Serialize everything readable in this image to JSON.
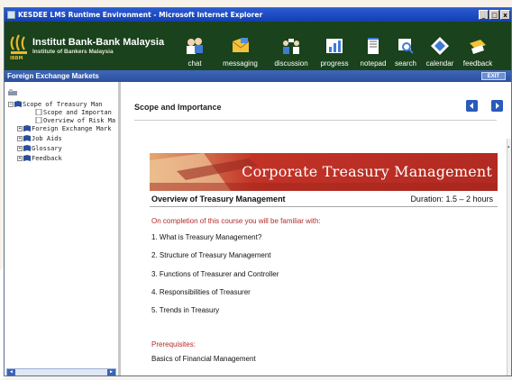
{
  "window": {
    "title": "KESDEE LMS Runtime Environment - Microsoft Internet Explorer",
    "controls": [
      "_",
      "□",
      "x"
    ]
  },
  "banner": {
    "org_name": "Institut Bank-Bank Malaysia",
    "org_subtitle": "Institute of Bankers Malaysia",
    "logo_abbr": "IBBM"
  },
  "toolbar": {
    "items": [
      {
        "label": "chat",
        "icon": "chat-icon"
      },
      {
        "label": "messaging",
        "icon": "messaging-icon"
      },
      {
        "label": "discussion",
        "icon": "discussion-icon"
      },
      {
        "label": "progress",
        "icon": "progress-icon"
      },
      {
        "label": "notepad",
        "icon": "notepad-icon"
      },
      {
        "label": "search",
        "icon": "search-icon"
      },
      {
        "label": "calendar",
        "icon": "calendar-icon"
      },
      {
        "label": "feedback",
        "icon": "feedback-icon"
      }
    ]
  },
  "coursebar": {
    "title": "Foreign Exchange Markets",
    "exit_label": "EXIT"
  },
  "nav": {
    "tree": [
      {
        "label": "Scope of Treasury Man",
        "expander": "⊟",
        "level": 0
      },
      {
        "label": "Scope and Importan",
        "expander": "",
        "level": 1
      },
      {
        "label": "Overview of Risk Ma",
        "expander": "",
        "level": 1
      },
      {
        "label": "Foreign Exchange Mark",
        "expander": "⊞",
        "level": 0
      },
      {
        "label": "Job Aids",
        "expander": "⊞",
        "level": 0
      },
      {
        "label": "Glossary",
        "expander": "⊞",
        "level": 0
      },
      {
        "label": "Feedback",
        "expander": "⊞",
        "level": 0
      }
    ]
  },
  "content": {
    "page_title": "Scope and Importance",
    "hero_title": "Corporate Treasury Management",
    "overview_title": "Overview of Treasury Management",
    "duration": "Duration:  1.5 – 2 hours",
    "intro": "On completion of this course you will be familiar with:",
    "objectives": [
      "1.  What is Treasury Management?",
      "2.  Structure of Treasury Management",
      "3.  Functions of Treasurer and Controller",
      "4.  Responsibilities of Treasurer",
      "5.  Trends in Treasury"
    ],
    "prereq_label": "Prerequisites:",
    "prereq_value": "Basics of Financial Management"
  },
  "colors": {
    "banner_bg": "#1a421c",
    "titlebar_bg": "#2b5bd4",
    "coursebar_bg": "#3f66b8",
    "accent_red": "#b22a2a",
    "hero_red": "#c23226"
  }
}
